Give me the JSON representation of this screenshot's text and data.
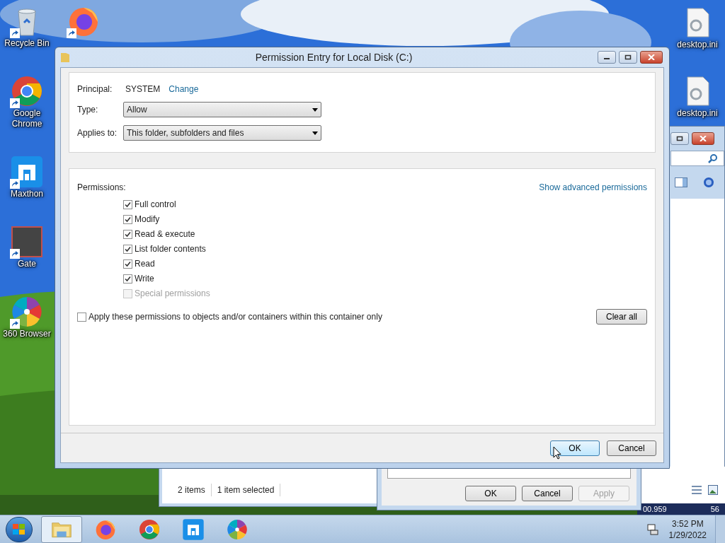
{
  "desktop_icons": [
    {
      "kind": "recycle",
      "label": "Recycle Bin"
    },
    {
      "kind": "chrome",
      "label": "Google Chrome"
    },
    {
      "kind": "maxthon",
      "label": "Maxthon"
    },
    {
      "kind": "gate",
      "label": "Gate"
    },
    {
      "kind": "browser360",
      "label": "360 Browser"
    }
  ],
  "covered_icon": {
    "kind": "firefox"
  },
  "right_icons": [
    {
      "kind": "ini",
      "label": "desktop.ini"
    },
    {
      "kind": "ini",
      "label": "desktop.ini"
    }
  ],
  "dialog": {
    "title": "Permission Entry for Local Disk (C:)",
    "principal_label": "Principal:",
    "principal_value": "SYSTEM",
    "change_link": "Change",
    "type_label": "Type:",
    "type_value": "Allow",
    "applies_label": "Applies to:",
    "applies_value": "This folder, subfolders and files",
    "permissions_label": "Permissions:",
    "advanced_link": "Show advanced permissions",
    "permissions": [
      {
        "label": "Full control",
        "checked": true,
        "disabled": false
      },
      {
        "label": "Modify",
        "checked": true,
        "disabled": false
      },
      {
        "label": "Read & execute",
        "checked": true,
        "disabled": false
      },
      {
        "label": "List folder contents",
        "checked": true,
        "disabled": false
      },
      {
        "label": "Read",
        "checked": true,
        "disabled": false
      },
      {
        "label": "Write",
        "checked": true,
        "disabled": false
      },
      {
        "label": "Special permissions",
        "checked": false,
        "disabled": true
      }
    ],
    "apply_only": {
      "label": "Apply these permissions to objects and/or containers within this container only",
      "checked": false
    },
    "clear_all": "Clear all",
    "ok": "OK",
    "cancel": "Cancel"
  },
  "explorer_status": [
    "2 items",
    "1 item selected"
  ],
  "properties_buttons": [
    {
      "label": "OK",
      "disabled": false
    },
    {
      "label": "Cancel",
      "disabled": false
    },
    {
      "label": "Apply",
      "disabled": true
    }
  ],
  "strip_texts": [
    "00.959",
    "56"
  ],
  "taskbar": {
    "apps": [
      {
        "kind": "explorer",
        "selected": true
      },
      {
        "kind": "firefox",
        "selected": false
      },
      {
        "kind": "chrome",
        "selected": false
      },
      {
        "kind": "maxthon",
        "selected": false
      },
      {
        "kind": "browser360",
        "selected": false
      }
    ],
    "time": "3:52 PM",
    "date": "1/29/2022"
  }
}
